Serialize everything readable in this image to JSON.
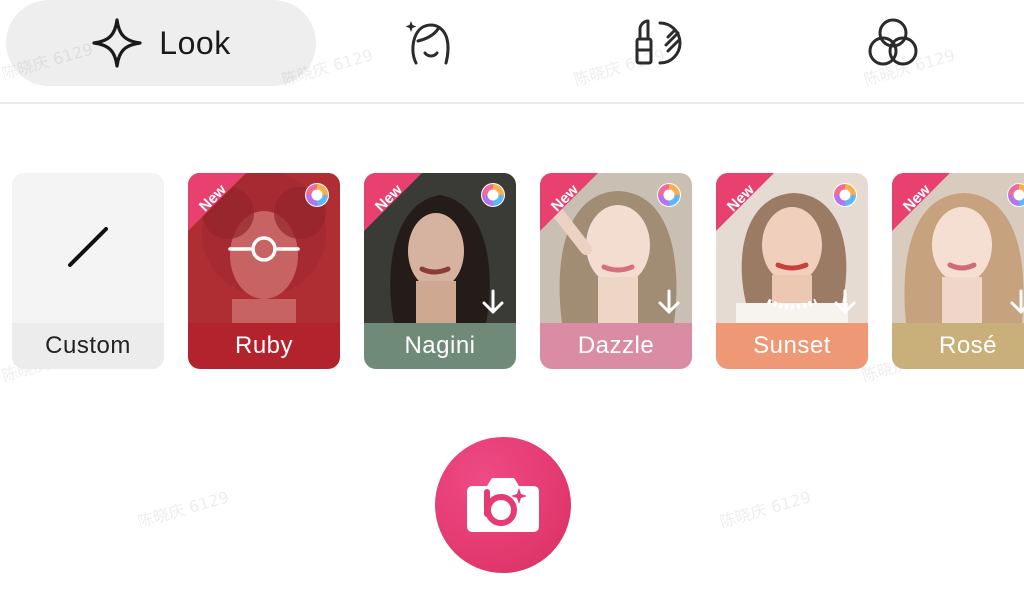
{
  "tabs": {
    "look": {
      "label": "Look",
      "icon": "sparkle-icon",
      "selected": true
    },
    "face": {
      "icon": "face-retouch-icon"
    },
    "makeup": {
      "icon": "lipstick-icon"
    },
    "filter": {
      "icon": "filter-circles-icon"
    }
  },
  "watermark": "陈晓庆 6129",
  "looks": [
    {
      "name": "Custom",
      "kind": "custom",
      "icon": "slash-icon"
    },
    {
      "name": "Ruby",
      "badge": "New",
      "bar_color": "#b3232e",
      "applied": true,
      "icons": [
        "new-badge",
        "app-logo-icon",
        "selected-slider-icon"
      ]
    },
    {
      "name": "Nagini",
      "badge": "New",
      "bar_color": "#6f8b77",
      "downloadable": true,
      "icons": [
        "new-badge",
        "app-logo-icon",
        "download-arrow-icon"
      ]
    },
    {
      "name": "Dazzle",
      "badge": "New",
      "bar_color": "#d98ca3",
      "downloadable": true,
      "icons": [
        "new-badge",
        "app-logo-icon",
        "download-arrow-icon"
      ]
    },
    {
      "name": "Sunset",
      "badge": "New",
      "bar_color": "#ef9876",
      "downloadable": true,
      "icons": [
        "new-badge",
        "app-logo-icon",
        "download-arrow-icon"
      ]
    },
    {
      "name": "Rosé",
      "badge": "New",
      "bar_color": "#c9b07a",
      "downloadable": true,
      "icons": [
        "new-badge",
        "app-logo-icon",
        "download-arrow-icon"
      ]
    }
  ],
  "shutter": {
    "icon": "camera-icon",
    "color": "#e63c74"
  },
  "colors": {
    "accent": "#e63c74",
    "new_badge": "#e8416f"
  }
}
